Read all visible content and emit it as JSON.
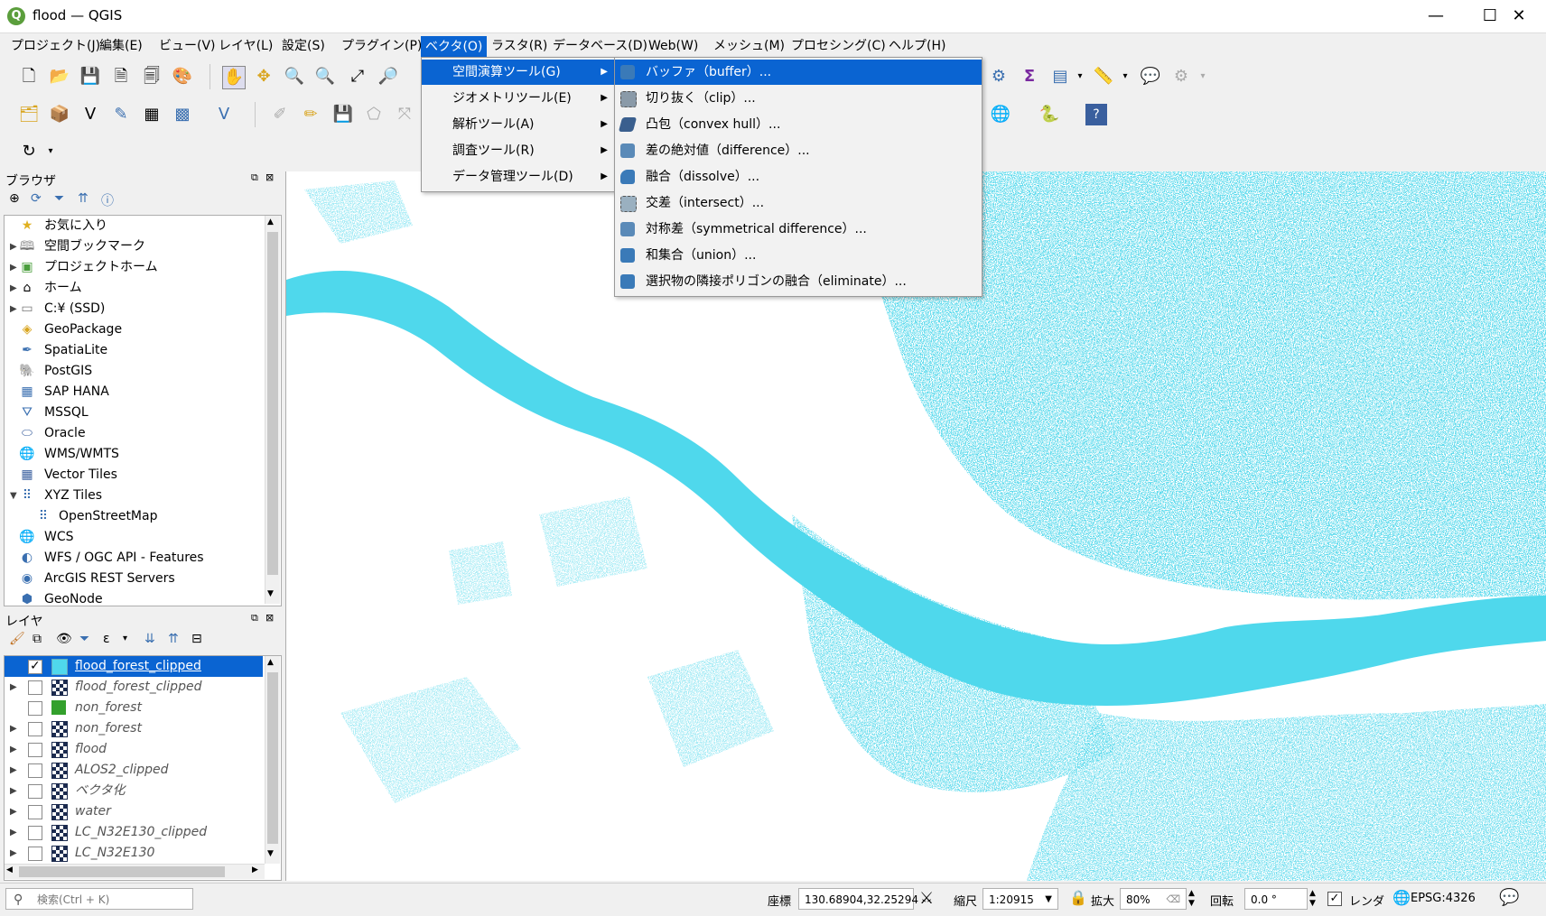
{
  "window": {
    "title": "flood — QGIS",
    "controls": {
      "minimize": "—",
      "maximize": "☐",
      "close": "✕"
    }
  },
  "menubar": [
    {
      "label": "プロジェクト(J)"
    },
    {
      "label": "編集(E)"
    },
    {
      "label": "ビュー(V)"
    },
    {
      "label": "レイヤ(L)"
    },
    {
      "label": "設定(S)"
    },
    {
      "label": "プラグイン(P)"
    },
    {
      "label": "ベクタ(O)",
      "active": true
    },
    {
      "label": "ラスタ(R)"
    },
    {
      "label": "データベース(D)"
    },
    {
      "label": "Web(W)"
    },
    {
      "label": "メッシュ(M)"
    },
    {
      "label": "プロセシング(C)"
    },
    {
      "label": "ヘルプ(H)"
    }
  ],
  "vector_menu": [
    {
      "label": "空間演算ツール(G)",
      "highlighted": true
    },
    {
      "label": "ジオメトリツール(E)"
    },
    {
      "label": "解析ツール(A)"
    },
    {
      "label": "調査ツール(R)"
    },
    {
      "label": "データ管理ツール(D)"
    }
  ],
  "geoprocessing_submenu": [
    {
      "label": "バッファ（buffer）...",
      "icon": "buffer-icon",
      "highlighted": true
    },
    {
      "label": "切り抜く（clip）...",
      "icon": "clip-icon"
    },
    {
      "label": "凸包（convex hull）...",
      "icon": "convex-hull-icon"
    },
    {
      "label": "差の絶対値（difference）...",
      "icon": "difference-icon"
    },
    {
      "label": "融合（dissolve）...",
      "icon": "dissolve-icon"
    },
    {
      "label": "交差（intersect）...",
      "icon": "intersect-icon"
    },
    {
      "label": "対称差（symmetrical difference）...",
      "icon": "symmetrical-difference-icon"
    },
    {
      "label": "和集合（union）...",
      "icon": "union-icon"
    },
    {
      "label": "選択物の隣接ポリゴンの融合（eliminate）...",
      "icon": "eliminate-icon"
    }
  ],
  "browser_panel": {
    "title": "ブラウザ",
    "items": [
      {
        "label": "お気に入り",
        "icon": "star-icon",
        "expandable": false
      },
      {
        "label": "空間ブックマーク",
        "icon": "bookmark-icon",
        "expandable": true
      },
      {
        "label": "プロジェクトホーム",
        "icon": "project-home-icon",
        "expandable": true
      },
      {
        "label": "ホーム",
        "icon": "home-icon",
        "expandable": true
      },
      {
        "label": "C:¥ (SSD)",
        "icon": "drive-icon",
        "expandable": true
      },
      {
        "label": "GeoPackage",
        "icon": "geopackage-icon",
        "expandable": false
      },
      {
        "label": "SpatiaLite",
        "icon": "spatialite-icon",
        "expandable": false
      },
      {
        "label": "PostGIS",
        "icon": "postgis-icon",
        "expandable": false
      },
      {
        "label": "SAP HANA",
        "icon": "sap-hana-icon",
        "expandable": false
      },
      {
        "label": "MSSQL",
        "icon": "mssql-icon",
        "expandable": false
      },
      {
        "label": "Oracle",
        "icon": "oracle-icon",
        "expandable": false
      },
      {
        "label": "WMS/WMTS",
        "icon": "globe-icon",
        "expandable": false
      },
      {
        "label": "Vector Tiles",
        "icon": "grid-icon",
        "expandable": false
      },
      {
        "label": "XYZ Tiles",
        "icon": "xyz-tiles-icon",
        "expandable": true,
        "expanded": true
      },
      {
        "label": "OpenStreetMap",
        "icon": "xyz-tiles-icon",
        "child": true
      },
      {
        "label": "WCS",
        "icon": "globe-icon",
        "expandable": false
      },
      {
        "label": "WFS / OGC API - Features",
        "icon": "wfs-icon",
        "expandable": false
      },
      {
        "label": "ArcGIS REST Servers",
        "icon": "arcgis-icon",
        "expandable": false
      },
      {
        "label": "GeoNode",
        "icon": "geonode-icon",
        "expandable": false
      }
    ]
  },
  "layers_panel": {
    "title": "レイヤ",
    "layers": [
      {
        "label": "flood_forest_clipped",
        "checked": true,
        "selected": true,
        "type": "fill",
        "color": "#4fd8ec"
      },
      {
        "label": "flood_forest_clipped",
        "checked": false,
        "type": "raster"
      },
      {
        "label": "non_forest",
        "checked": false,
        "type": "fill",
        "color": "#33a02c"
      },
      {
        "label": "non_forest",
        "checked": false,
        "type": "raster"
      },
      {
        "label": "flood",
        "checked": false,
        "type": "raster"
      },
      {
        "label": "ALOS2_clipped",
        "checked": false,
        "type": "raster"
      },
      {
        "label": "ベクタ化",
        "checked": false,
        "type": "raster"
      },
      {
        "label": "water",
        "checked": false,
        "type": "raster"
      },
      {
        "label": "LC_N32E130_clipped",
        "checked": false,
        "type": "raster"
      },
      {
        "label": "LC_N32E130",
        "checked": false,
        "type": "raster"
      }
    ]
  },
  "map": {
    "flood_color": "#4fd8ec"
  },
  "statusbar": {
    "search_placeholder": "検索(Ctrl + K)",
    "coordinate_label": "座標",
    "coordinate_value": "130.68904,32.25294",
    "scale_label": "縮尺",
    "scale_value": "1:20915",
    "magnifier_label": "拡大",
    "magnifier_value": "80%",
    "rotation_label": "回転",
    "rotation_value": "0.0 °",
    "render_label": "レンダ",
    "crs_label": "EPSG:4326"
  }
}
